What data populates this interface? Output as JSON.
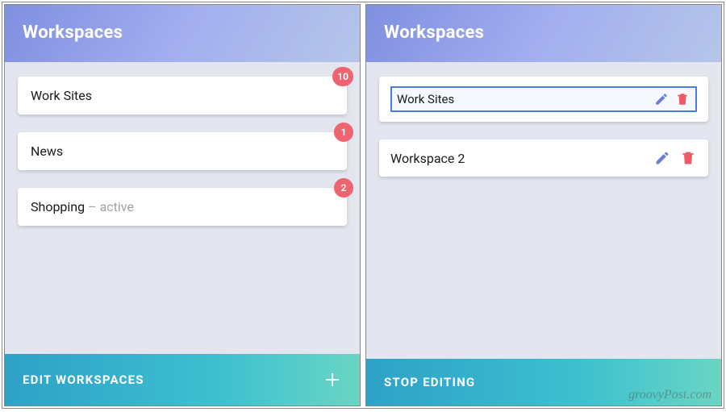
{
  "left": {
    "header": "Workspaces",
    "items": [
      {
        "name": "Work Sites",
        "badge": "10",
        "active": false
      },
      {
        "name": "News",
        "badge": "1",
        "active": false
      },
      {
        "name": "Shopping",
        "badge": "2",
        "active": true,
        "active_label": "– active"
      }
    ],
    "footer_label": "EDIT WORKSPACES"
  },
  "right": {
    "header": "Workspaces",
    "edit_items": [
      {
        "name": "Work Sites",
        "editing": true
      },
      {
        "name": "Workspace 2",
        "editing": false
      }
    ],
    "footer_label": "STOP EDITING"
  },
  "icons": {
    "pencil": "pencil-icon",
    "trash": "trash-icon",
    "plus": "plus-icon"
  },
  "colors": {
    "badge": "#ee6470",
    "pencil": "#6b7ed8",
    "trash": "#ee5a66",
    "focus_border": "#4a7de0"
  },
  "watermark": "groovyPost.com"
}
